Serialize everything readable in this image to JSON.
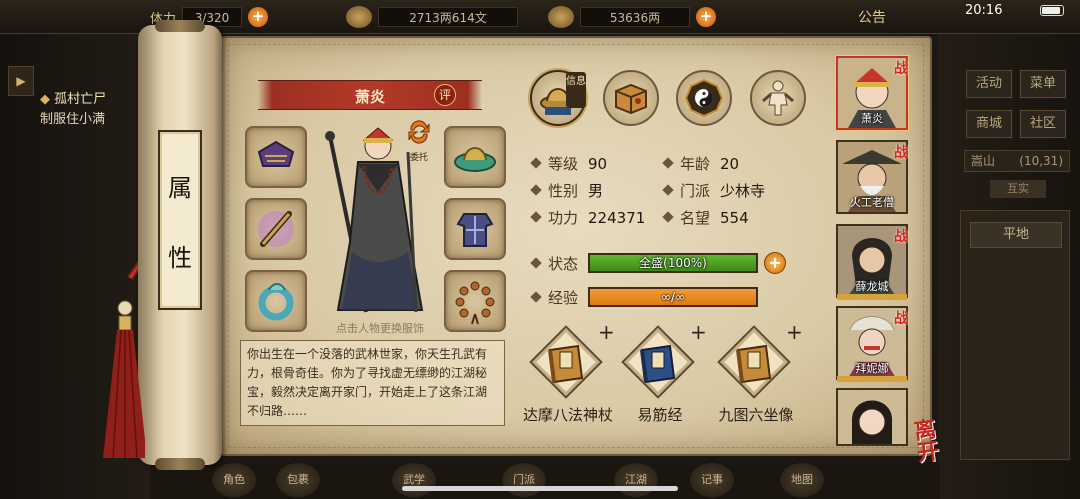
{
  "topbar": {
    "stamina_label": "体力",
    "stamina_value": "3/320",
    "silver": "2713两614文",
    "gold": "53636两",
    "notice": "公告",
    "time": "20:16"
  },
  "quest": {
    "title": "孤村亡尸",
    "desc": "制服住小满"
  },
  "right_menu": {
    "buttons": [
      "活动",
      "菜单",
      "商城",
      "社区"
    ],
    "location": "嵩山",
    "coords": "(10,31)",
    "sub": "互实",
    "plain": "平地"
  },
  "bottom_nav": [
    "角色",
    "包裹",
    "武学",
    "门派",
    "江湖",
    "记事",
    "地图"
  ],
  "scroll_label": [
    "属",
    "性"
  ],
  "character": {
    "name": "萧炎",
    "rate_label": "评",
    "entrust_label": "委托",
    "change_hint": "点击人物更换服饰",
    "bio": "你出生在一个没落的武林世家，你天生孔武有力，根骨奇佳。你为了寻找虚无缥缈的江湖秘宝，毅然决定离开家门，开始走上了这条江湖不归路……"
  },
  "tabs": {
    "info_label": "信息",
    "items": [
      "info-hat-icon",
      "map-scroll-icon",
      "bagua-icon",
      "body-meridian-icon"
    ]
  },
  "stats": {
    "level_label": "等级",
    "level": "90",
    "age_label": "年龄",
    "age": "20",
    "gender_label": "性别",
    "gender": "男",
    "sect_label": "门派",
    "sect": "少林寺",
    "power_label": "功力",
    "power": "224371",
    "fame_label": "名望",
    "fame": "554",
    "state_label": "状态",
    "state_text": "全盛(100%)",
    "state_pct": 100,
    "exp_label": "经验",
    "exp_text": "∞/∞",
    "exp_pct": 100
  },
  "skills": [
    {
      "name": "达摩八法神杖",
      "plus": "+"
    },
    {
      "name": "易筋经",
      "plus": "+"
    },
    {
      "name": "九图六坐像",
      "plus": "+"
    }
  ],
  "party": [
    {
      "name": "萧炎",
      "tag": "战",
      "selected": true
    },
    {
      "name": "火工老僧",
      "tag": "战"
    },
    {
      "name": "薛龙城",
      "tag": "战"
    },
    {
      "name": "拜妮娜",
      "tag": "战"
    },
    {
      "name": ""
    }
  ],
  "leave_label": "离开",
  "colors": {
    "state_bar": "#5fb82c",
    "exp_bar": "#e07a12",
    "banner": "#b33a28"
  }
}
